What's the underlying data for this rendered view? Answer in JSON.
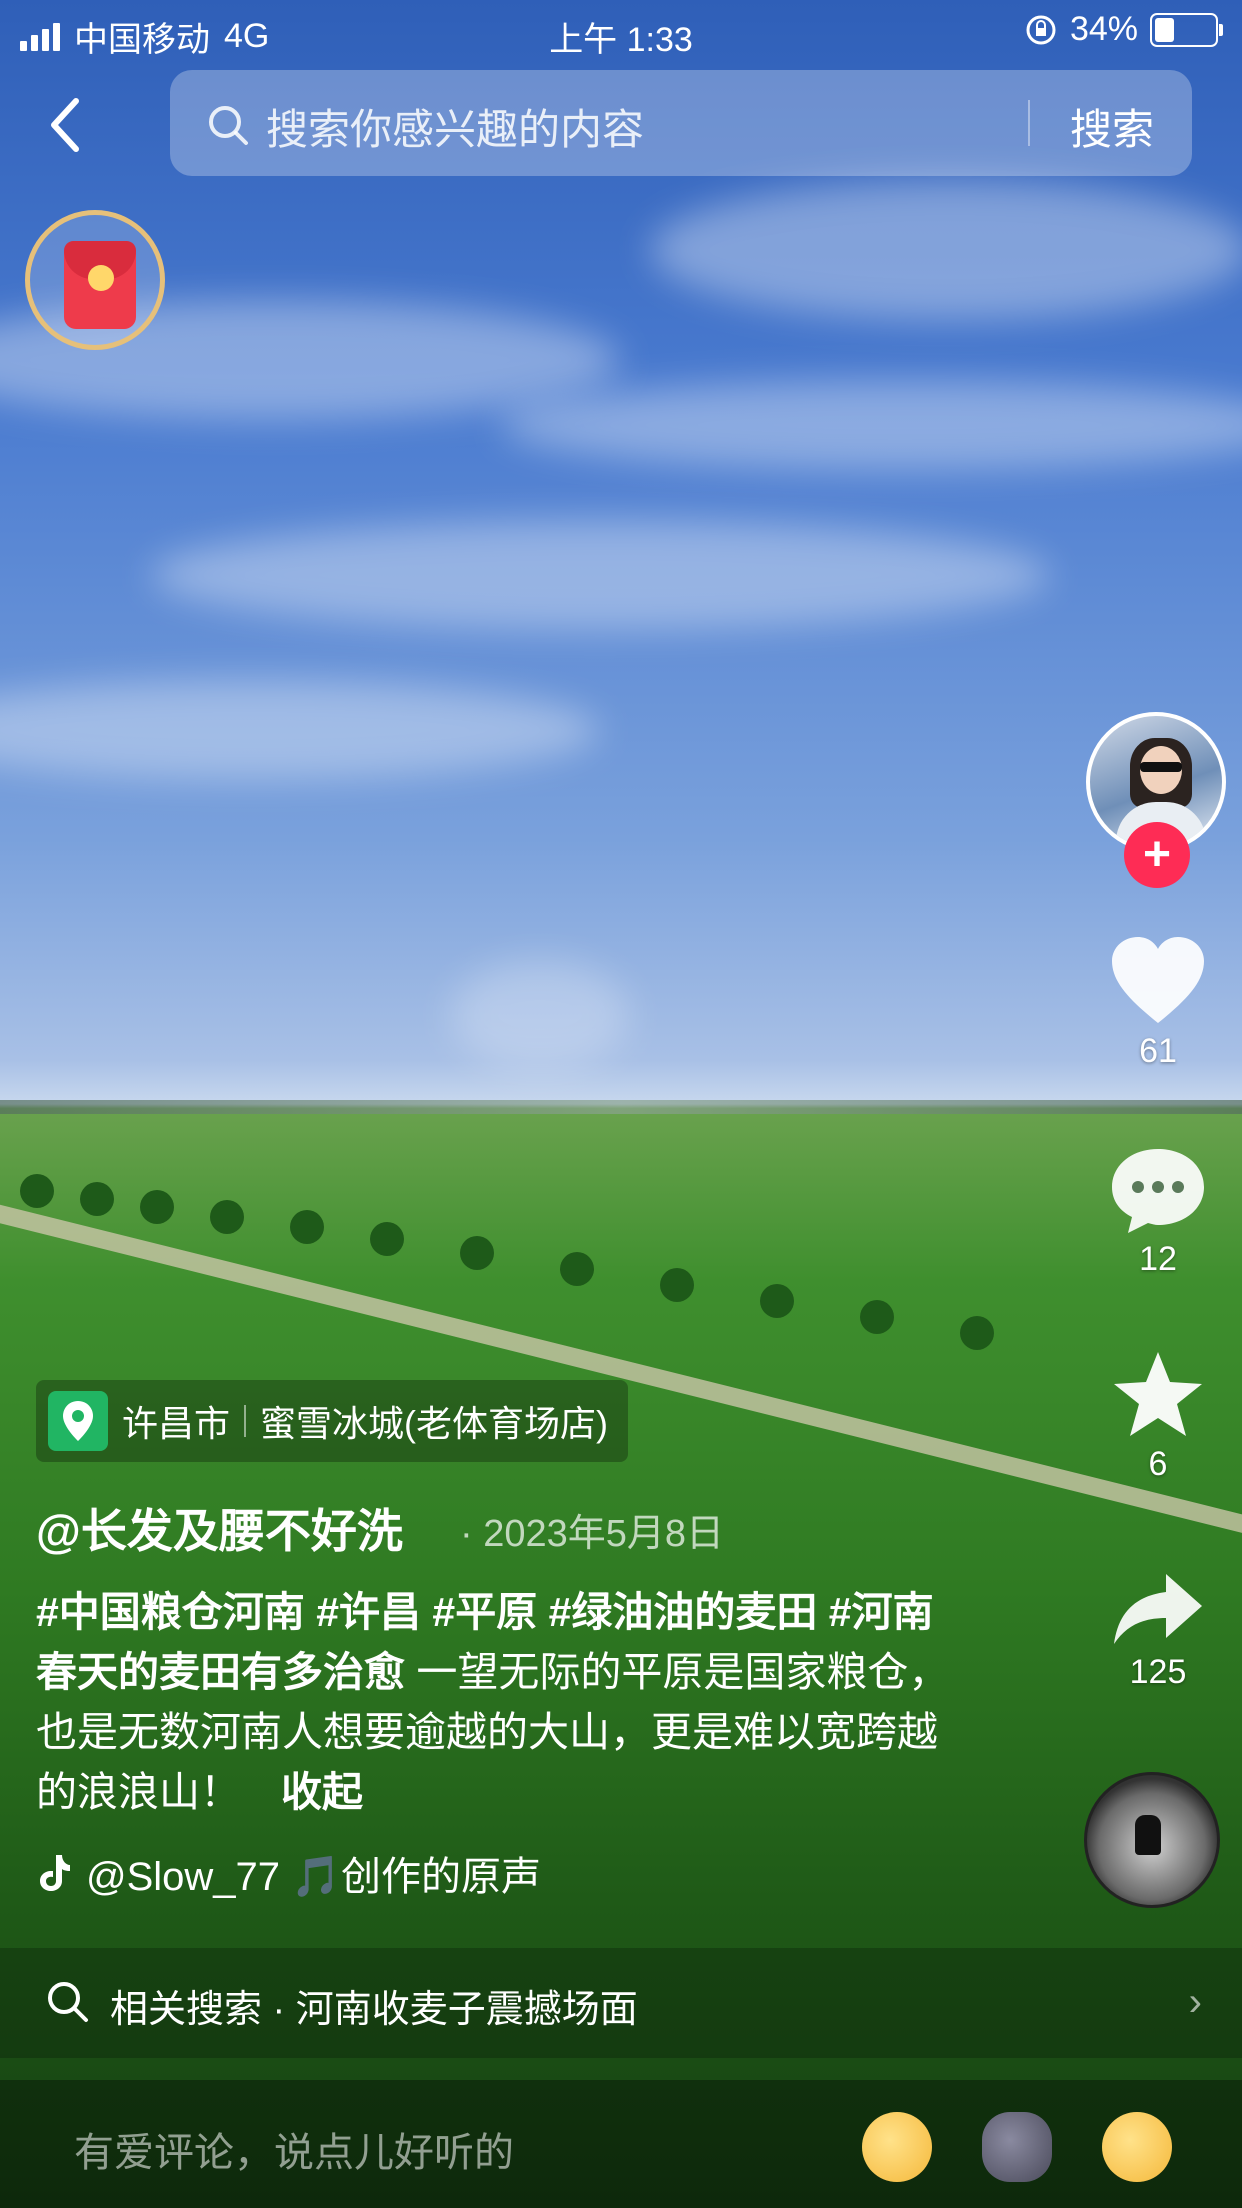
{
  "status_bar": {
    "carrier": "中国移动",
    "network": "4G",
    "time": "上午 1:33",
    "battery": "34%"
  },
  "search": {
    "placeholder": "搜索你感兴趣的内容",
    "button_label": "搜索"
  },
  "actions": {
    "likes": "61",
    "comments": "12",
    "favorites": "6",
    "shares": "125"
  },
  "location": {
    "city": "许昌市",
    "place": "蜜雪冰城(老体育场店)"
  },
  "post": {
    "author": "@长发及腰不好洗",
    "date": "· 2023年5月8日",
    "tags": "#中国粮仓河南 #许昌 #平原 #绿油油的麦田 #河南春天的麦田有多治愈",
    "caption": " 一望无际的平原是国家粮仓，也是无数河南人想要逾越的大山，更是难以宽跨越的浪浪山！",
    "toggle": "收起"
  },
  "music": {
    "text": "@Slow_77 🎵创作的原声"
  },
  "related_search": {
    "text": "相关搜索 · 河南收麦子震撼场面"
  },
  "comment_bar": {
    "placeholder": "有爱评论，说点儿好听的"
  },
  "icons": [
    "back-icon",
    "search-icon",
    "red-packet-icon",
    "heart-icon",
    "comment-icon",
    "star-icon",
    "share-icon",
    "location-pin-icon",
    "tiktok-icon",
    "chevron-right-icon"
  ],
  "colors": {
    "follow_red": "#fe2c55",
    "location_green": "#21b563",
    "red_packet": "#ee3b4b"
  }
}
